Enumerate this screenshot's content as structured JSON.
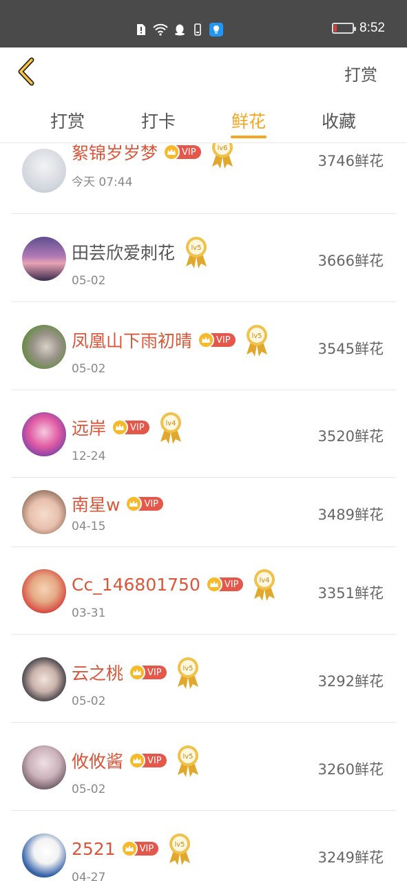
{
  "status_bar": {
    "time": "8:52"
  },
  "header": {
    "action_label": "打赏"
  },
  "tabs": [
    {
      "label": "打赏"
    },
    {
      "label": "打卡"
    },
    {
      "label": "鲜花",
      "active": true
    },
    {
      "label": "收藏"
    }
  ],
  "vip_label": "VIP",
  "colors": {
    "accent": "#f5a623",
    "name_color": "#d9563a",
    "vip_badge": "#e4574b"
  },
  "rows": [
    {
      "name": "絮锦岁岁梦",
      "vip": true,
      "level": "lv6",
      "date": "今天 07:44",
      "amount": "3746鲜花"
    },
    {
      "name": "田芸欣爱刺花",
      "vip": false,
      "level": "lv5",
      "date": "05-02",
      "amount": "3666鲜花"
    },
    {
      "name": "凤凰山下雨初晴",
      "vip": true,
      "level": "lv5",
      "date": "05-02",
      "amount": "3545鲜花"
    },
    {
      "name": "远岸",
      "vip": true,
      "level": "lv4",
      "date": "12-24",
      "amount": "3520鲜花"
    },
    {
      "name": "南星w",
      "vip": true,
      "level": "",
      "date": "04-15",
      "amount": "3489鲜花"
    },
    {
      "name": "Cc_146801750",
      "vip": true,
      "level": "lv4",
      "date": "03-31",
      "amount": "3351鲜花"
    },
    {
      "name": "云之桃",
      "vip": true,
      "level": "lv5",
      "date": "05-02",
      "amount": "3292鲜花"
    },
    {
      "name": "攸攸酱",
      "vip": true,
      "level": "lv5",
      "date": "05-02",
      "amount": "3260鲜花"
    },
    {
      "name": "2521",
      "vip": true,
      "level": "lv5",
      "date": "04-27",
      "amount": "3249鲜花"
    }
  ]
}
